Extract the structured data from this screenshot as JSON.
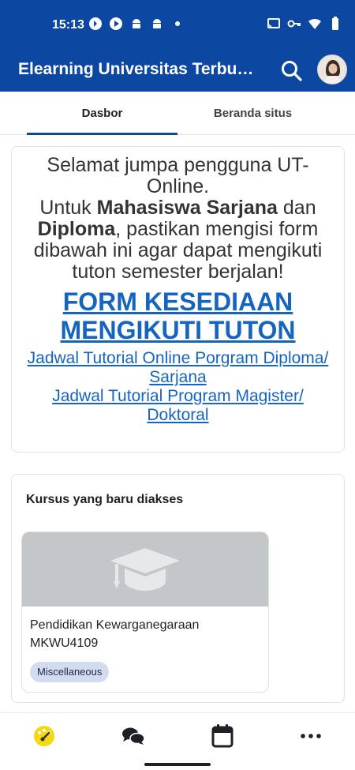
{
  "status_bar": {
    "time": "15:13",
    "left_icons": [
      "bluetooth-audio-icon",
      "play-circle-icon",
      "android-icon",
      "android-icon",
      "dot-icon"
    ],
    "right_icons": [
      "cast-icon",
      "vpn-key-icon",
      "wifi-icon",
      "battery-icon"
    ]
  },
  "app_bar": {
    "title": "Elearning Universitas Terbuka",
    "search_icon": "search-icon",
    "avatar_icon": "user-avatar",
    "background_color": "#0c47a1"
  },
  "tabs": [
    {
      "label": "Dasbor",
      "active": true
    },
    {
      "label": "Beranda situs",
      "active": false
    }
  ],
  "welcome": {
    "greeting": "Selamat jumpa pengguna UT-Online.",
    "line1_prefix": "Untuk ",
    "line1_bold": "Mahasiswa Sarjana",
    "line1_suffix": " dan",
    "line2_bold": "Diploma",
    "line2_suffix": ", pastikan mengisi form dibawah ini agar dapat mengikuti tuton semester berjalan!",
    "form_link": "FORM KESEDIAAN MENGIKUTI TUTON",
    "schedule_links": [
      "Jadwal Tutorial Online Porgram Diploma/ Sarjana",
      "Jadwal Tutorial Program Magister/ Doktoral"
    ],
    "link_color": "#1565c0"
  },
  "recent_courses": {
    "title": "Kursus yang baru diakses",
    "courses": [
      {
        "name": "Pendidikan Kewarganegaraan MKWU4109",
        "category": "Miscellaneous",
        "image_icon": "graduation-cap-icon"
      }
    ]
  },
  "bottom_nav": {
    "items": [
      {
        "icon": "dashboard-icon",
        "active": true
      },
      {
        "icon": "messages-icon",
        "active": false
      },
      {
        "icon": "calendar-icon",
        "active": false
      },
      {
        "icon": "more-icon",
        "active": false
      }
    ],
    "active_color": "#f5d90f"
  }
}
